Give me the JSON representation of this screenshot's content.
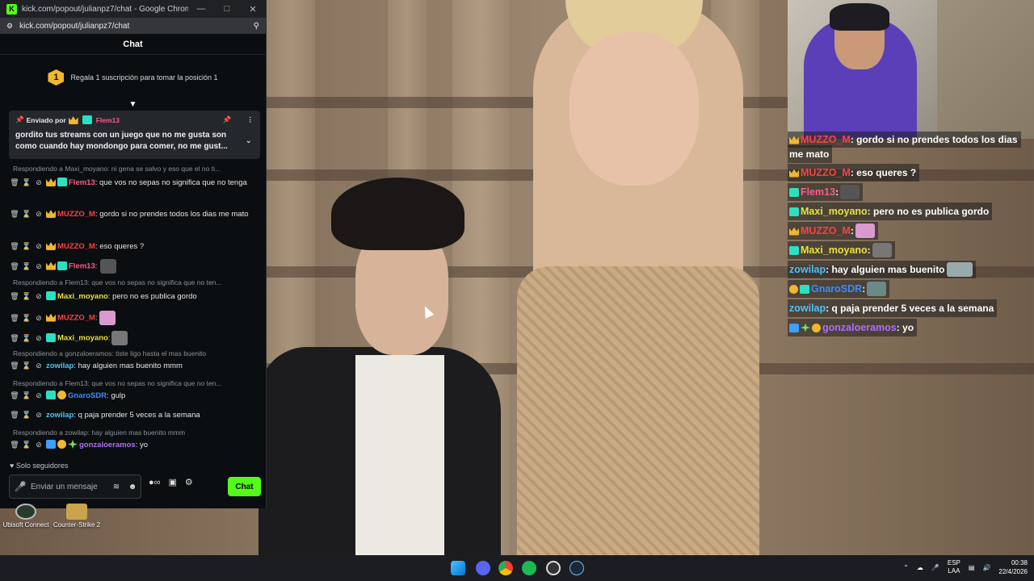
{
  "browser": {
    "title": "kick.com/popout/julianpz7/chat - Google Chrome",
    "url": "kick.com/popout/julianpz7/chat",
    "favicon": "K"
  },
  "chat": {
    "header": "Chat",
    "promo_rank": "1",
    "promo_text": "Regala 1 suscripción para tomar la posición 1",
    "pinned": {
      "sent_by_label": "Enviado por",
      "user": "Flem13",
      "message": "gordito tus streams con un juego que no me gusta son como cuando hay mondongo para comer, no me gust..."
    },
    "messages": [
      {
        "reply": "Respondiendo a Maxi_moyano: ni gena se salvo y eso que el no ti...",
        "user": "Flem13",
        "text": ": que vos no sepas no significa que no tenga"
      },
      {
        "user": "MUZZO_M",
        "text": ": gordo si no prendes todos los dias me mato"
      },
      {
        "user": "MUZZO_M",
        "text": ": eso queres ?"
      },
      {
        "user": "Flem13",
        "text": ":"
      },
      {
        "reply": "Respondiendo a Flem13: que vos no sepas no significa que no ten...",
        "user": "Maxi_moyano",
        "text": ": pero no es publica gordo"
      },
      {
        "user": "MUZZO_M",
        "text": ":"
      },
      {
        "user": "Maxi_moyano",
        "text": ":"
      },
      {
        "reply": "Respondiendo a gonzaloeramos: tiste ligo hasta el mas buenito",
        "user": "zowilap",
        "text": ": hay alguien mas buenito mmm"
      },
      {
        "reply": "Respondiendo a Flem13: que vos no sepas no significa que no ten...",
        "user": "GnaroSDR",
        "text": ": gulp"
      },
      {
        "user": "zowilap",
        "text": ": q paja prender 5 veces a la semana"
      },
      {
        "reply": "Respondiendo a zowilap: hay alguien mas buenito mmm",
        "user": "gonzaloeramos",
        "text": ": yo"
      }
    ],
    "followers_only": "Solo seguidores",
    "input_placeholder": "Enviar un mensaje",
    "send_label": "Chat"
  },
  "desktop_icons": [
    "Ubisoft Connect",
    "Counter-Strike 2"
  ],
  "overlay": {
    "lines": [
      {
        "user": "MUZZO_M",
        "text": ": gordo si no prendes todos los dias"
      },
      {
        "text": "me mato"
      },
      {
        "user": "MUZZO_M",
        "text": ": eso queres ?"
      },
      {
        "user": "Flem13",
        "text": ":"
      },
      {
        "user": "Maxi_moyano",
        "text": ": pero no es publica gordo"
      },
      {
        "user": "MUZZO_M",
        "text": ":"
      },
      {
        "user": "Maxi_moyano",
        "text": ":"
      },
      {
        "user": "zowilap",
        "text": ": hay alguien mas buenito"
      },
      {
        "user": "GnaroSDR",
        "text": ":"
      },
      {
        "user": "zowilap",
        "text": ": q paja prender 5 veces a la semana"
      },
      {
        "user": "gonzaloeramos",
        "text": ": yo"
      }
    ]
  },
  "taskbar": {
    "lang_top": "ESP",
    "lang_bottom": "LAA",
    "time": "00:38",
    "date": "22/4/2026"
  },
  "colors": {
    "kick_green": "#53fc18",
    "chat_bg": "#0b0e10",
    "pinned_bg": "#24272c"
  },
  "icons": [
    "pin-icon",
    "more-icon",
    "trash-icon",
    "timeout-icon",
    "ban-icon",
    "mic-icon",
    "translate-icon",
    "emoji-icon",
    "store-icon",
    "gear-icon",
    "windows-start-icon",
    "discord-icon",
    "chrome-icon",
    "spotify-icon",
    "obs-icon",
    "steam-icon"
  ]
}
